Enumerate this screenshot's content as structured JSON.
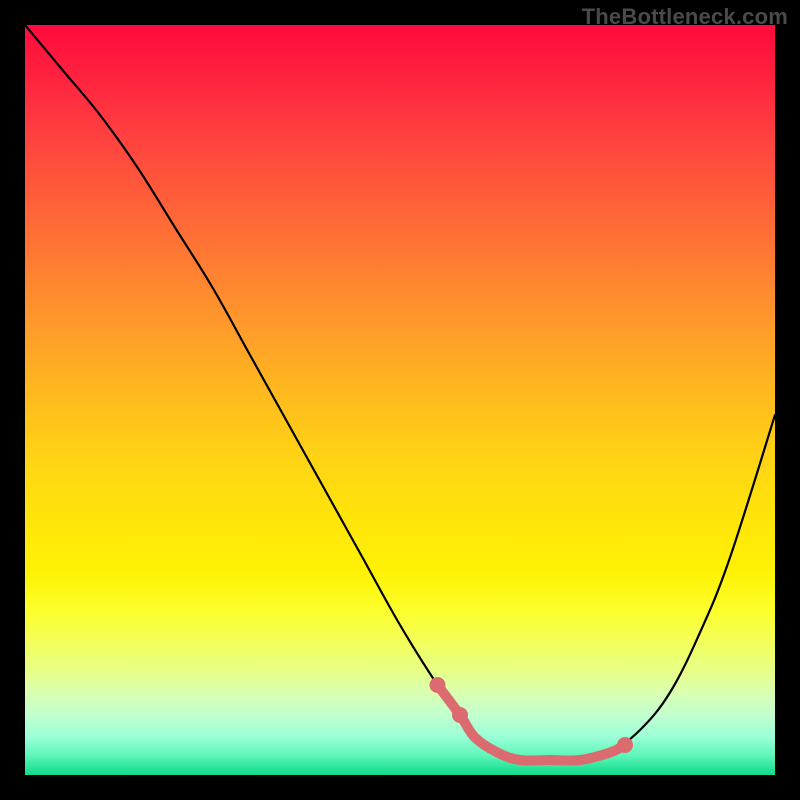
{
  "watermark": "TheBottleneck.com",
  "chart_data": {
    "type": "line",
    "title": "",
    "xlabel": "",
    "ylabel": "",
    "xlim": [
      0,
      100
    ],
    "ylim": [
      0,
      100
    ],
    "series": [
      {
        "name": "bottleneck-curve",
        "x": [
          0,
          5,
          10,
          15,
          20,
          25,
          30,
          35,
          40,
          45,
          50,
          55,
          58,
          60,
          63,
          66,
          70,
          74,
          78,
          82,
          86,
          90,
          94,
          100
        ],
        "values": [
          100,
          94,
          88,
          81,
          73,
          65,
          56,
          47,
          38,
          29,
          20,
          12,
          8,
          5,
          3,
          2,
          2,
          2,
          3,
          6,
          11,
          19,
          29,
          48
        ]
      }
    ],
    "highlight": {
      "name": "optimal-range",
      "x": [
        55,
        58,
        60,
        63,
        66,
        70,
        74,
        78,
        80
      ],
      "values": [
        12,
        8,
        5,
        3,
        2,
        2,
        2,
        3,
        4
      ]
    },
    "highlight_points": [
      {
        "x": 55,
        "y": 12
      },
      {
        "x": 58,
        "y": 8
      },
      {
        "x": 80,
        "y": 4
      }
    ],
    "background_gradient": {
      "top": "#ff0a3c",
      "mid": "#ffe50a",
      "bottom": "#16d98d"
    }
  }
}
